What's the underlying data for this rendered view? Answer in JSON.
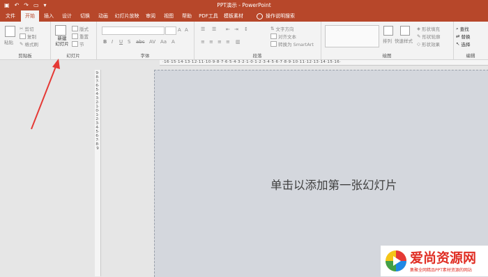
{
  "window": {
    "title": "PPT演示 - PowerPoint"
  },
  "tabs": [
    {
      "label": "文件"
    },
    {
      "label": "开始"
    },
    {
      "label": "插入"
    },
    {
      "label": "设计"
    },
    {
      "label": "切换"
    },
    {
      "label": "动画"
    },
    {
      "label": "幻灯片放映"
    },
    {
      "label": "审阅"
    },
    {
      "label": "视图"
    },
    {
      "label": "帮助"
    },
    {
      "label": "PDF工具"
    },
    {
      "label": "模板素材"
    }
  ],
  "tell_me": {
    "label": "操作说明搜索"
  },
  "clipboard": {
    "label": "剪贴板",
    "paste": "粘贴",
    "cut": "剪切",
    "copy": "复制",
    "format_painter": "格式刷"
  },
  "slides": {
    "label": "幻灯片",
    "new_slide_line1": "新建",
    "new_slide_line2": "幻灯片",
    "layout": "版式",
    "reset": "重置",
    "section": "节"
  },
  "font": {
    "label": "字体"
  },
  "paragraph": {
    "label": "段落",
    "text_direction": "文字方向",
    "align_text": "对齐文本",
    "smartart": "转换为 SmartArt"
  },
  "drawing": {
    "label": "绘图",
    "arrange": "排列",
    "quick_styles": "快速样式",
    "shape_fill": "形状填充",
    "shape_outline": "形状轮廓",
    "shape_effects": "形状效果"
  },
  "editing": {
    "label": "编辑",
    "find": "查找",
    "replace": "替换",
    "select": "选择"
  },
  "rulers": {
    "horizontal": "·16·15·14·13·12·11·10·9·8·7·6·5·4·3·2·1·0·1·2·3·4·5·6·7·8·9·10·11·12·13·14·15·16·",
    "vertical": "9·8·7·6·5·4·3·2·1·0·1·2·3·4·5·6·7·8·9"
  },
  "slide": {
    "placeholder": "单击以添加第一张幻灯片"
  },
  "watermark": {
    "name": "爱尚资源网",
    "tagline": "集聚全网精品PPT素材资源的网站"
  },
  "colors": {
    "accent": "#b7472a",
    "ribbon_bg": "#f3f3f3",
    "slide_bg": "#d4d7dd",
    "arrow": "#e53935",
    "watermark_red": "#e02e24"
  }
}
